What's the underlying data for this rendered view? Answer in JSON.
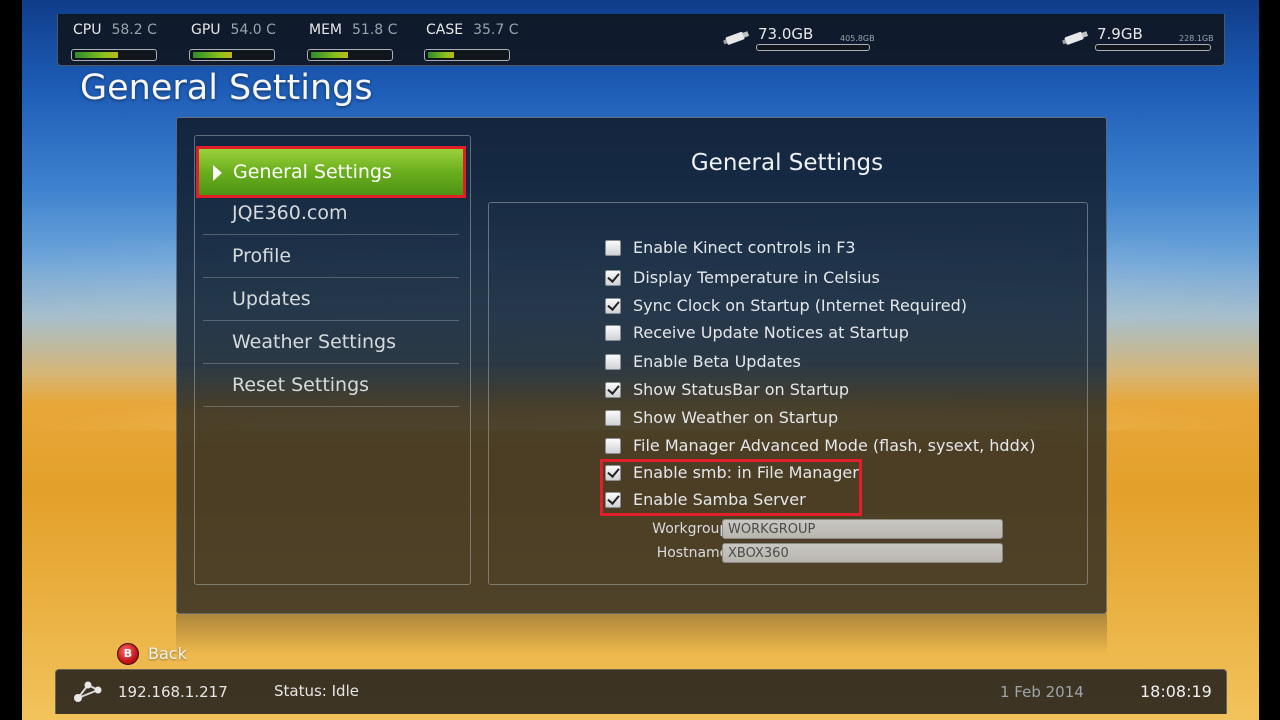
{
  "topbar": {
    "sensors": [
      {
        "label": "CPU",
        "value": "58.2 C",
        "level": 0.55
      },
      {
        "label": "GPU",
        "value": "54.0 C",
        "level": 0.5
      },
      {
        "label": "MEM",
        "value": "51.8 C",
        "level": 0.48
      },
      {
        "label": "CASE",
        "value": "35.7 C",
        "level": 0.33
      }
    ],
    "drives": [
      {
        "icon": "usb-drive-icon",
        "free": "73.0GB",
        "total": "405.8GB"
      },
      {
        "icon": "usb-drive-icon",
        "free": "7.9GB",
        "total": "228.1GB"
      }
    ]
  },
  "page_title": "General Settings",
  "sidebar": {
    "items": [
      {
        "label": "General Settings",
        "active": true
      },
      {
        "label": "JQE360.com"
      },
      {
        "label": "Profile"
      },
      {
        "label": "Updates"
      },
      {
        "label": "Weather Settings"
      },
      {
        "label": "Reset Settings"
      }
    ]
  },
  "panel": {
    "title": "General Settings",
    "options": [
      {
        "label": "Enable Kinect controls in F3",
        "checked": false
      },
      {
        "label": "Display Temperature in Celsius",
        "checked": true
      },
      {
        "label": "Sync Clock on Startup (Internet Required)",
        "checked": true
      },
      {
        "label": "Receive Update Notices at Startup",
        "checked": false
      },
      {
        "label": "Enable Beta Updates",
        "checked": false
      },
      {
        "label": "Show StatusBar on Startup",
        "checked": true
      },
      {
        "label": "Show Weather on Startup",
        "checked": false
      },
      {
        "label": "File Manager Advanced Mode (flash, sysext, hddx)",
        "checked": false
      },
      {
        "label": "Enable smb: in File Manager",
        "checked": true
      },
      {
        "label": "Enable Samba Server",
        "checked": true
      }
    ],
    "workgroup": {
      "label": "Workgroup:",
      "value": "WORKGROUP"
    },
    "hostname": {
      "label": "Hostname:",
      "value": "XBOX360"
    }
  },
  "back": {
    "button": "B",
    "label": "Back"
  },
  "bottombar": {
    "ip": "192.168.1.217",
    "status": "Status: Idle",
    "date": "1 Feb 2014",
    "time": "18:08:19"
  },
  "colors": {
    "highlight_red": "#e01f2a",
    "active_green": "#6aae1e"
  }
}
